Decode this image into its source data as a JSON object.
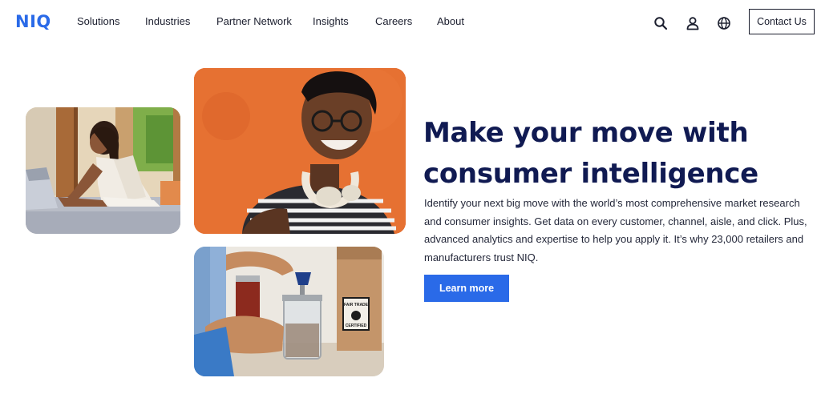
{
  "brand": {
    "logo_text": "NIQ",
    "accent": "#2a6ae8",
    "title_color": "#101a52"
  },
  "nav": {
    "items": [
      {
        "label": "Solutions"
      },
      {
        "label": "Industries"
      },
      {
        "label": "Partner Network"
      },
      {
        "label": "Insights"
      },
      {
        "label": "Careers"
      },
      {
        "label": "About"
      }
    ],
    "icons": [
      "search-icon",
      "user-icon",
      "globe-icon"
    ],
    "contact_label": "Contact Us"
  },
  "hero": {
    "title_lines": [
      "Make your move with",
      "consumer intelligence"
    ],
    "body_lines": [
      "Identify your next big move with the world’s most comprehensive market research",
      "and consumer insights. Get data on every customer, channel, aisle, and click. Plus,",
      "advanced analytics and expertise to help you apply it. It’s why 23,000 retailers and",
      "manufacturers trust NIQ."
    ],
    "cta_label": "Learn more"
  },
  "photos": {
    "coffee_bag_label": [
      "FAIR TRADE",
      "CERTIFIED"
    ]
  }
}
